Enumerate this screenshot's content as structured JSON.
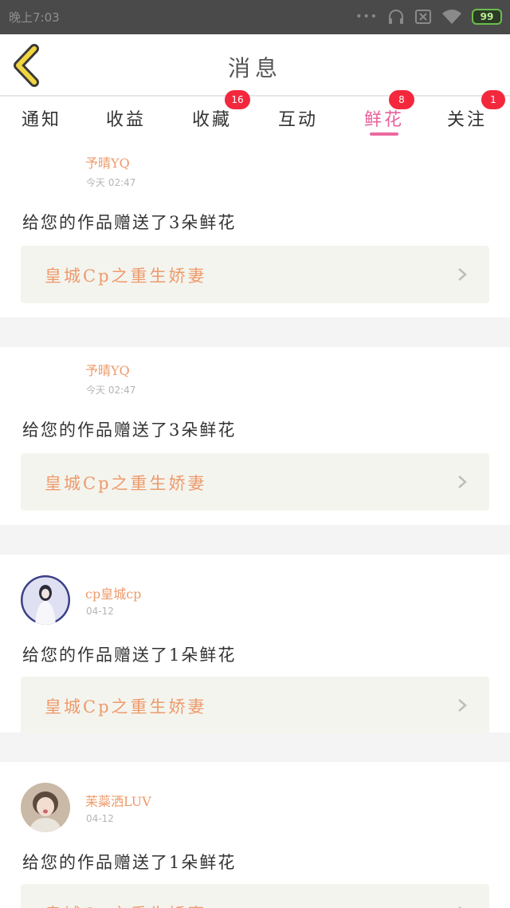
{
  "status_bar": {
    "time": "晚上7:03",
    "battery": "99"
  },
  "header": {
    "title": "消息"
  },
  "tabs": [
    {
      "label": "通知",
      "badge": null,
      "active": false
    },
    {
      "label": "收益",
      "badge": null,
      "active": false
    },
    {
      "label": "收藏",
      "badge": "16",
      "active": false
    },
    {
      "label": "互动",
      "badge": null,
      "active": false
    },
    {
      "label": "鲜花",
      "badge": "8",
      "active": true
    },
    {
      "label": "关注",
      "badge": "1",
      "active": false
    }
  ],
  "messages": [
    {
      "user": "予晴YQ",
      "time": "今天 02:47",
      "text": "给您的作品赠送了3朵鲜花",
      "work_title": "皇城Cp之重生娇妻",
      "avatar": false
    },
    {
      "user": "予晴YQ",
      "time": "今天 02:47",
      "text": "给您的作品赠送了3朵鲜花",
      "work_title": "皇城Cp之重生娇妻",
      "avatar": false
    },
    {
      "user": "cp皇城cp",
      "time": "04-12",
      "text": "给您的作品赠送了1朵鲜花",
      "work_title": "皇城Cp之重生娇妻",
      "avatar": true
    },
    {
      "user": "苿蘂洒LUV",
      "time": "04-12",
      "text": "给您的作品赠送了1朵鲜花",
      "work_title": "皇城Cp之重生娇妻",
      "avatar": true
    }
  ],
  "colors": {
    "accent_pink": "#e9619c",
    "name_orange": "#ee9a6a",
    "badge_red": "#f3283d",
    "back_arrow_yellow": "#f2d640"
  }
}
